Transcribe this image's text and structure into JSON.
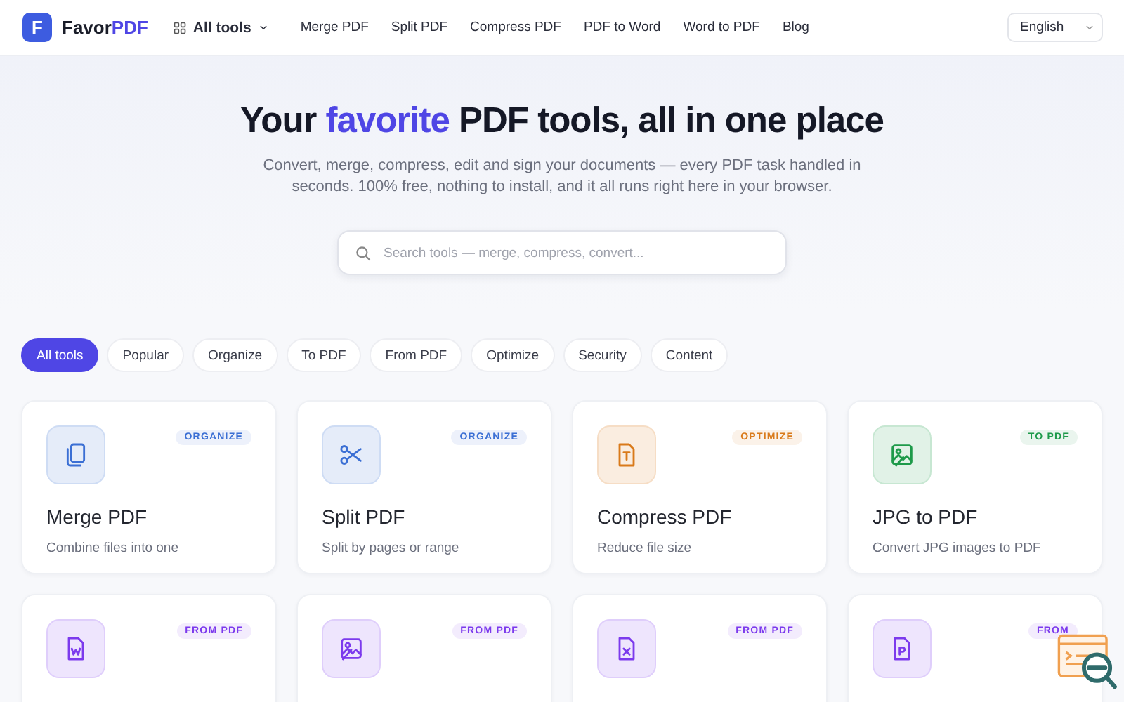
{
  "header": {
    "logo_mark": "F",
    "brand": {
      "name": "Favor",
      "accent": "PDF"
    },
    "menu": {
      "label": "All tools",
      "expanded": false
    },
    "nav": [
      "Merge PDF",
      "Split PDF",
      "Compress PDF",
      "PDF to Word",
      "Word to PDF",
      "Blog"
    ],
    "language": "English"
  },
  "hero": {
    "title": {
      "before": "Your",
      "accent": "favorite",
      "after": "PDF tools, all in one place"
    },
    "subtitle": "Convert, merge, compress, edit and sign your documents — every PDF task handled in seconds. 100% free, nothing to install, and it all runs right here in your browser.",
    "search": {
      "placeholder": "Search tools — merge, compress, convert..."
    }
  },
  "filters": [
    {
      "label": "All tools",
      "selected": true
    },
    {
      "label": "Popular",
      "selected": false
    },
    {
      "label": "Organize",
      "selected": false
    },
    {
      "label": "To PDF",
      "selected": false
    },
    {
      "label": "From PDF",
      "selected": false
    },
    {
      "label": "Optimize",
      "selected": false
    },
    {
      "label": "Security",
      "selected": false
    },
    {
      "label": "Content",
      "selected": false
    }
  ],
  "tools": [
    {
      "title": "Merge PDF",
      "description": "Combine files into one",
      "tag": "ORGANIZE",
      "color": "#3b6fd4"
    },
    {
      "title": "Split PDF",
      "description": "Split by pages or range",
      "tag": "ORGANIZE",
      "color": "#3b6fd4"
    },
    {
      "title": "Compress PDF",
      "description": "Reduce file size",
      "tag": "OPTIMIZE",
      "color": "#d97a1a"
    },
    {
      "title": "JPG to PDF",
      "description": "Convert JPG images to PDF",
      "tag": "TO PDF",
      "color": "#1e9a4a"
    },
    {
      "tag": "FROM PDF",
      "color": "#7c3aed"
    },
    {
      "tag": "FROM PDF",
      "color": "#7c3aed"
    },
    {
      "tag": "FROM PDF",
      "color": "#7c3aed"
    },
    {
      "tag": "FROM",
      "color": "#7c3aed"
    }
  ]
}
